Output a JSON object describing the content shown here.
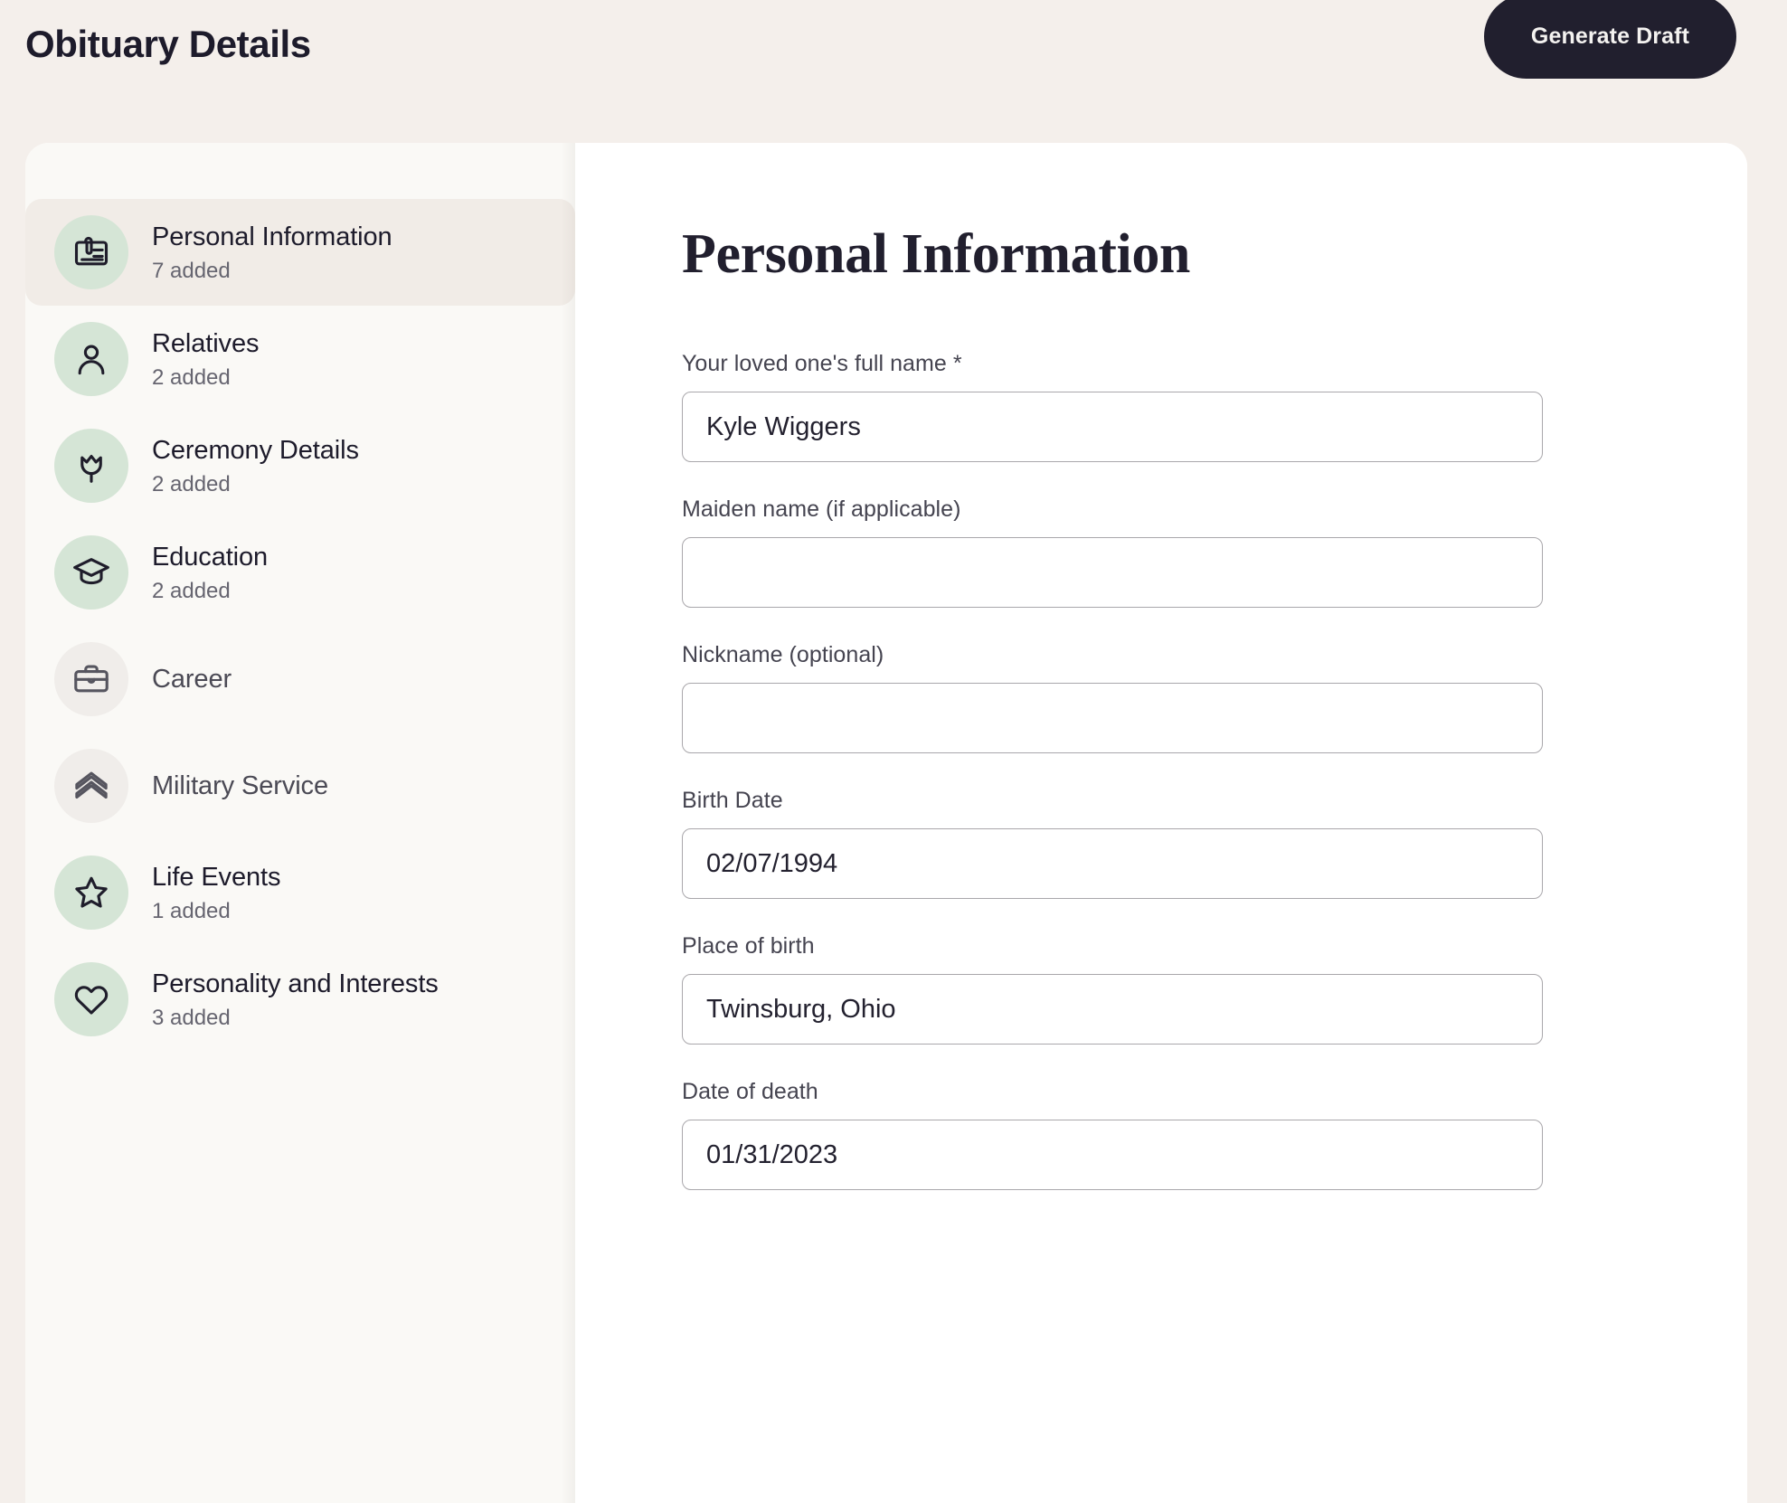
{
  "header": {
    "title": "Obituary Details",
    "generate_button_label": "Generate Draft"
  },
  "sidebar": {
    "items": [
      {
        "label": "Personal Information",
        "count": "7 added",
        "icon": "id-card-icon",
        "active": true,
        "empty": false
      },
      {
        "label": "Relatives",
        "count": "2 added",
        "icon": "person-icon",
        "active": false,
        "empty": false
      },
      {
        "label": "Ceremony Details",
        "count": "2 added",
        "icon": "tulip-icon",
        "active": false,
        "empty": false
      },
      {
        "label": "Education",
        "count": "2 added",
        "icon": "graduation-cap-icon",
        "active": false,
        "empty": false
      },
      {
        "label": "Career",
        "count": "",
        "icon": "briefcase-icon",
        "active": false,
        "empty": true
      },
      {
        "label": "Military Service",
        "count": "",
        "icon": "chevron-rank-icon",
        "active": false,
        "empty": true
      },
      {
        "label": "Life Events",
        "count": "1 added",
        "icon": "star-icon",
        "active": false,
        "empty": false
      },
      {
        "label": "Personality and Interests",
        "count": "3 added",
        "icon": "heart-icon",
        "active": false,
        "empty": false
      }
    ]
  },
  "main": {
    "section_title": "Personal Information",
    "fields": [
      {
        "label": "Your loved one's full name *",
        "value": "Kyle Wiggers",
        "placeholder": ""
      },
      {
        "label": "Maiden name (if applicable)",
        "value": "",
        "placeholder": ""
      },
      {
        "label": "Nickname (optional)",
        "value": "",
        "placeholder": ""
      },
      {
        "label": "Birth Date",
        "value": "02/07/1994",
        "placeholder": ""
      },
      {
        "label": "Place of birth",
        "value": "Twinsburg, Ohio",
        "placeholder": ""
      },
      {
        "label": "Date of death",
        "value": "01/31/2023",
        "placeholder": ""
      }
    ]
  },
  "colors": {
    "page_background": "#f4efeb",
    "card_background": "#ffffff",
    "sidebar_background": "#faf9f6",
    "accent_dark": "#211f2e",
    "icon_circle_green": "#d5e5d6",
    "icon_circle_gray": "#f0edea",
    "active_row": "#f1ece7"
  }
}
